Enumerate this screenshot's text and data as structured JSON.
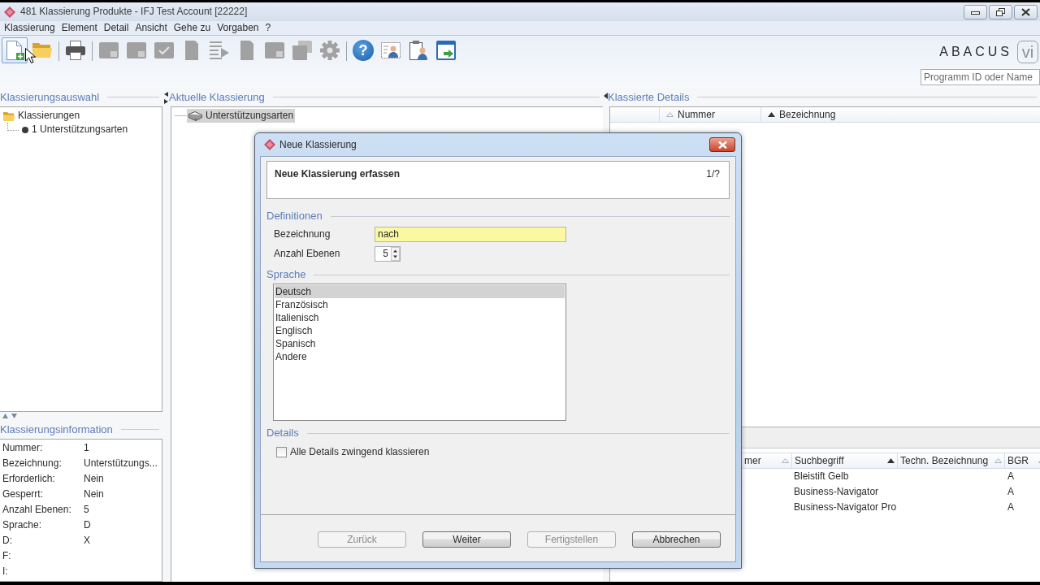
{
  "window": {
    "title": "481 Klassierung Produkte - IFJ Test Account [22222]"
  },
  "menu": [
    "Klassierung",
    "Element",
    "Detail",
    "Ansicht",
    "Gehe zu",
    "Vorgaben",
    "?"
  ],
  "toolbar": [
    [
      {
        "kind": "newfile",
        "disabled": false,
        "hover": true
      },
      {
        "kind": "folder",
        "disabled": false,
        "hover": false
      }
    ],
    [
      {
        "kind": "printer",
        "disabled": false,
        "hover": false
      }
    ],
    [
      {
        "kind": "document",
        "disabled": true,
        "hover": false
      },
      {
        "kind": "document",
        "disabled": true,
        "hover": false
      },
      {
        "kind": "checkdoc",
        "disabled": true,
        "hover": false
      },
      {
        "kind": "page",
        "disabled": true,
        "hover": false
      },
      {
        "kind": "listing",
        "disabled": true,
        "hover": false
      },
      {
        "kind": "page",
        "disabled": true,
        "hover": false
      },
      {
        "kind": "document",
        "disabled": true,
        "hover": false
      },
      {
        "kind": "stack",
        "disabled": true,
        "hover": false
      },
      {
        "kind": "gear",
        "disabled": true,
        "hover": false
      }
    ],
    [
      {
        "kind": "help",
        "label": "?",
        "disabled": false,
        "hover": false
      },
      {
        "kind": "contact",
        "disabled": false,
        "hover": false
      },
      {
        "kind": "clipboard",
        "disabled": false,
        "hover": false
      },
      {
        "kind": "window",
        "disabled": false,
        "hover": false
      }
    ]
  ],
  "logo": {
    "name": "ABACUS",
    "badge": "vi"
  },
  "search": {
    "placeholder": "Programm ID oder Name"
  },
  "selection_panel": {
    "title": "Klassierungsauswahl",
    "tree": [
      {
        "label": "Klassierungen",
        "kind": "folder",
        "children": [
          {
            "label": "1 Unterstützungsarten",
            "kind": "leaf"
          }
        ]
      }
    ]
  },
  "info_panel": {
    "title": "Klassierungsinformation",
    "rows": [
      {
        "label": "Nummer:",
        "value": "1"
      },
      {
        "label": "Bezeichnung:",
        "value": "Unterstützungs..."
      },
      {
        "label": "Erforderlich:",
        "value": "Nein"
      },
      {
        "label": "Gesperrt:",
        "value": "Nein"
      },
      {
        "label": "Anzahl Ebenen:",
        "value": "5"
      },
      {
        "label": "Sprache:",
        "value": "D"
      },
      {
        "label": "D:",
        "value": "X"
      },
      {
        "label": "F:"
      },
      {
        "label": "I:"
      }
    ]
  },
  "current_panel": {
    "title": "Aktuelle Klassierung",
    "tree": [
      {
        "label": "Unterstützungsarten",
        "selected": true
      }
    ]
  },
  "details_panel": {
    "title": "Klassierte Details",
    "columns": [
      {
        "label": "Nummer",
        "sorted": false
      },
      {
        "label": "Bezeichnung",
        "sorted": true
      }
    ],
    "lower_table": {
      "columns": [
        {
          "label": "mer",
          "sorted": false
        },
        {
          "label": "Suchbegriff",
          "sorted": true
        },
        {
          "label": "Techn. Bezeichnung",
          "sorted": false
        },
        {
          "label": "BGR",
          "sorted": false
        }
      ],
      "rows": [
        {
          "suchbegriff": "Bleistift Gelb",
          "bgr": "A"
        },
        {
          "suchbegriff": "Business-Navigator",
          "bgr": "A"
        },
        {
          "suchbegriff": "Business-Navigator Pro",
          "bgr": "A"
        }
      ]
    }
  },
  "dialog": {
    "title": "Neue Klassierung",
    "heading": "Neue Klassierung erfassen",
    "step": "1/?",
    "definitions": {
      "title": "Definitionen",
      "fields": [
        {
          "label": "Bezeichnung",
          "value": "nach",
          "kind": "text",
          "highlighted": true
        },
        {
          "label": "Anzahl Ebenen",
          "value": "5",
          "kind": "spinner",
          "highlighted": false
        }
      ]
    },
    "language": {
      "title": "Sprache",
      "items": [
        {
          "label": "Deutsch",
          "selected": true
        },
        {
          "label": "Französisch",
          "selected": false
        },
        {
          "label": "Italienisch",
          "selected": false
        },
        {
          "label": "Englisch",
          "selected": false
        },
        {
          "label": "Spanisch",
          "selected": false
        },
        {
          "label": "Andere",
          "selected": false
        }
      ]
    },
    "details": {
      "title": "Details",
      "checkbox": {
        "label": "Alle Details zwingend klassieren",
        "checked": false
      }
    },
    "buttons": [
      {
        "label": "Zurück",
        "disabled": true
      },
      {
        "label": "Weiter",
        "disabled": false
      },
      {
        "label": "Fertigstellen",
        "disabled": true
      },
      {
        "label": "Abbrechen",
        "disabled": false
      }
    ]
  }
}
